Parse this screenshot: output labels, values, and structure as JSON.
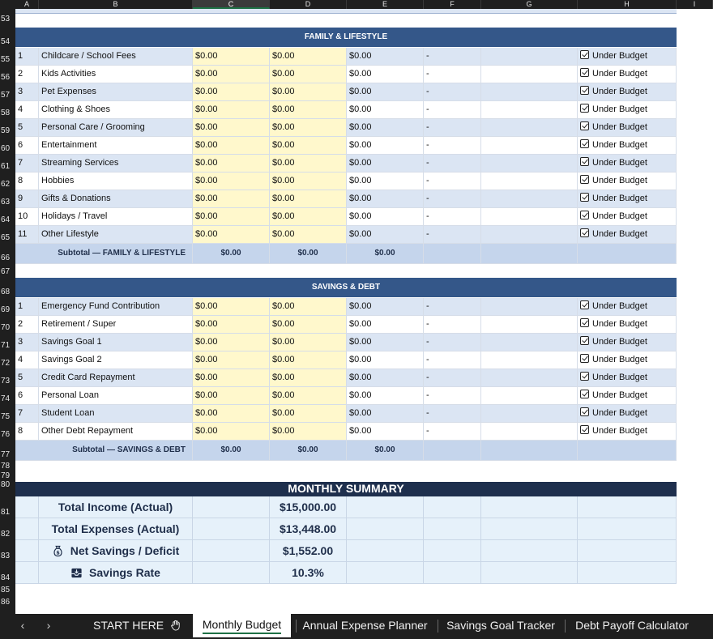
{
  "columns": [
    "A",
    "B",
    "C",
    "D",
    "E",
    "F",
    "G",
    "H",
    "I"
  ],
  "active_column": "C",
  "row_numbers_top": [
    "53",
    "54"
  ],
  "family": {
    "header_row": "54",
    "title": "FAMILY & LIFESTYLE",
    "items": [
      {
        "row": "55",
        "num": "1",
        "name": "Childcare / School Fees",
        "c": "$0.00",
        "d": "$0.00",
        "e": "$0.00",
        "f": "-",
        "status": "Under Budget"
      },
      {
        "row": "56",
        "num": "2",
        "name": "Kids Activities",
        "c": "$0.00",
        "d": "$0.00",
        "e": "$0.00",
        "f": "-",
        "status": "Under Budget"
      },
      {
        "row": "57",
        "num": "3",
        "name": "Pet Expenses",
        "c": "$0.00",
        "d": "$0.00",
        "e": "$0.00",
        "f": "-",
        "status": "Under Budget"
      },
      {
        "row": "58",
        "num": "4",
        "name": "Clothing & Shoes",
        "c": "$0.00",
        "d": "$0.00",
        "e": "$0.00",
        "f": "-",
        "status": "Under Budget"
      },
      {
        "row": "59",
        "num": "5",
        "name": "Personal Care / Grooming",
        "c": "$0.00",
        "d": "$0.00",
        "e": "$0.00",
        "f": "-",
        "status": "Under Budget"
      },
      {
        "row": "60",
        "num": "6",
        "name": "Entertainment",
        "c": "$0.00",
        "d": "$0.00",
        "e": "$0.00",
        "f": "-",
        "status": "Under Budget"
      },
      {
        "row": "61",
        "num": "7",
        "name": "Streaming Services",
        "c": "$0.00",
        "d": "$0.00",
        "e": "$0.00",
        "f": "-",
        "status": "Under Budget"
      },
      {
        "row": "62",
        "num": "8",
        "name": "Hobbies",
        "c": "$0.00",
        "d": "$0.00",
        "e": "$0.00",
        "f": "-",
        "status": "Under Budget"
      },
      {
        "row": "63",
        "num": "9",
        "name": "Gifts & Donations",
        "c": "$0.00",
        "d": "$0.00",
        "e": "$0.00",
        "f": "-",
        "status": "Under Budget"
      },
      {
        "row": "64",
        "num": "10",
        "name": "Holidays / Travel",
        "c": "$0.00",
        "d": "$0.00",
        "e": "$0.00",
        "f": "-",
        "status": "Under Budget"
      },
      {
        "row": "65",
        "num": "11",
        "name": "Other Lifestyle",
        "c": "$0.00",
        "d": "$0.00",
        "e": "$0.00",
        "f": "-",
        "status": "Under Budget"
      }
    ],
    "subtotal": {
      "row": "66",
      "label": "Subtotal — FAMILY & LIFESTYLE",
      "c": "$0.00",
      "d": "$0.00",
      "e": "$0.00"
    }
  },
  "gap1_row": "67",
  "savings": {
    "header_row": "68",
    "title": "SAVINGS & DEBT",
    "items": [
      {
        "row": "69",
        "num": "1",
        "name": "Emergency Fund Contribution",
        "c": "$0.00",
        "d": "$0.00",
        "e": "$0.00",
        "f": "-",
        "status": "Under Budget"
      },
      {
        "row": "70",
        "num": "2",
        "name": "Retirement / Super",
        "c": "$0.00",
        "d": "$0.00",
        "e": "$0.00",
        "f": "-",
        "status": "Under Budget"
      },
      {
        "row": "71",
        "num": "3",
        "name": "Savings Goal 1",
        "c": "$0.00",
        "d": "$0.00",
        "e": "$0.00",
        "f": "-",
        "status": "Under Budget"
      },
      {
        "row": "72",
        "num": "4",
        "name": "Savings Goal 2",
        "c": "$0.00",
        "d": "$0.00",
        "e": "$0.00",
        "f": "-",
        "status": "Under Budget"
      },
      {
        "row": "73",
        "num": "5",
        "name": "Credit Card Repayment",
        "c": "$0.00",
        "d": "$0.00",
        "e": "$0.00",
        "f": "-",
        "status": "Under Budget"
      },
      {
        "row": "74",
        "num": "6",
        "name": "Personal Loan",
        "c": "$0.00",
        "d": "$0.00",
        "e": "$0.00",
        "f": "-",
        "status": "Under Budget"
      },
      {
        "row": "75",
        "num": "7",
        "name": "Student Loan",
        "c": "$0.00",
        "d": "$0.00",
        "e": "$0.00",
        "f": "-",
        "status": "Under Budget"
      },
      {
        "row": "76",
        "num": "8",
        "name": "Other Debt Repayment",
        "c": "$0.00",
        "d": "$0.00",
        "e": "$0.00",
        "f": "-",
        "status": "Under Budget"
      }
    ],
    "subtotal": {
      "row": "77",
      "label": "Subtotal — SAVINGS & DEBT",
      "c": "$0.00",
      "d": "$0.00",
      "e": "$0.00"
    }
  },
  "gap_rows": [
    "78",
    "79"
  ],
  "summary": {
    "header_row": "80",
    "title": "MONTHLY SUMMARY",
    "rows": [
      {
        "row": "81",
        "label": "Total Income (Actual)",
        "value": "$15,000.00",
        "icon": ""
      },
      {
        "row": "82",
        "label": "Total Expenses (Actual)",
        "value": "$13,448.00",
        "icon": ""
      },
      {
        "row": "83",
        "label": "Net Savings / Deficit",
        "value": "$1,552.00",
        "icon": "money-bag-icon"
      },
      {
        "row": "84",
        "label": "Savings Rate",
        "value": "10.3%",
        "icon": "inbox-tray-icon"
      }
    ]
  },
  "bottom_rows": [
    "85",
    "86"
  ],
  "tabs": {
    "items": [
      "START HERE",
      "Monthly Budget",
      "Annual Expense Planner",
      "Savings Goal Tracker",
      "Debt Payoff Calculator"
    ],
    "active": "Monthly Budget",
    "start_icon": "hand-icon"
  },
  "colors": {
    "section_header": "#345789",
    "summary_header": "#1e2f4d",
    "row_alt": "#dbe5f3",
    "input_yellow": "#fff8cc",
    "subtotal": "#c5d5ec"
  }
}
